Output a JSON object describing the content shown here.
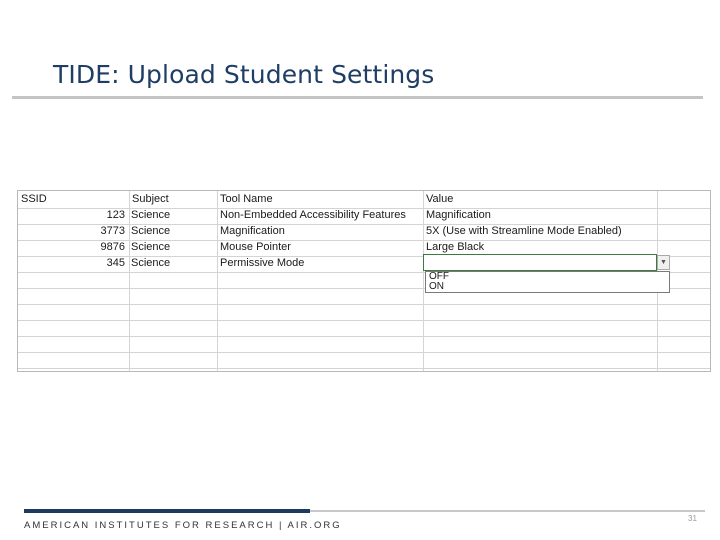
{
  "slide": {
    "title": "TIDE: Upload Student Settings",
    "footer": "AMERICAN INSTITUTES FOR RESEARCH | AIR.ORG",
    "page_number": "31"
  },
  "spreadsheet": {
    "headers": [
      "SSID",
      "Subject",
      "Tool Name",
      "Value"
    ],
    "rows": [
      {
        "ssid": "123",
        "subject": "Science",
        "tool": "Non-Embedded Accessibility Features",
        "value": "Magnification"
      },
      {
        "ssid": "3773",
        "subject": "Science",
        "tool": "Magnification",
        "value": "5X (Use with Streamline Mode Enabled)"
      },
      {
        "ssid": "9876",
        "subject": "Science",
        "tool": "Mouse Pointer",
        "value": "Large Black"
      },
      {
        "ssid": "345",
        "subject": "Science",
        "tool": "Permissive Mode",
        "value": ""
      }
    ],
    "dropdown": {
      "options": [
        "OFF",
        "ON"
      ],
      "arrow_icon": "dropdown-arrow-icon"
    }
  },
  "colors": {
    "title": "#1f3e66",
    "footer_bar": "#1f3a5f",
    "selected_border": "#3d7a3d"
  }
}
